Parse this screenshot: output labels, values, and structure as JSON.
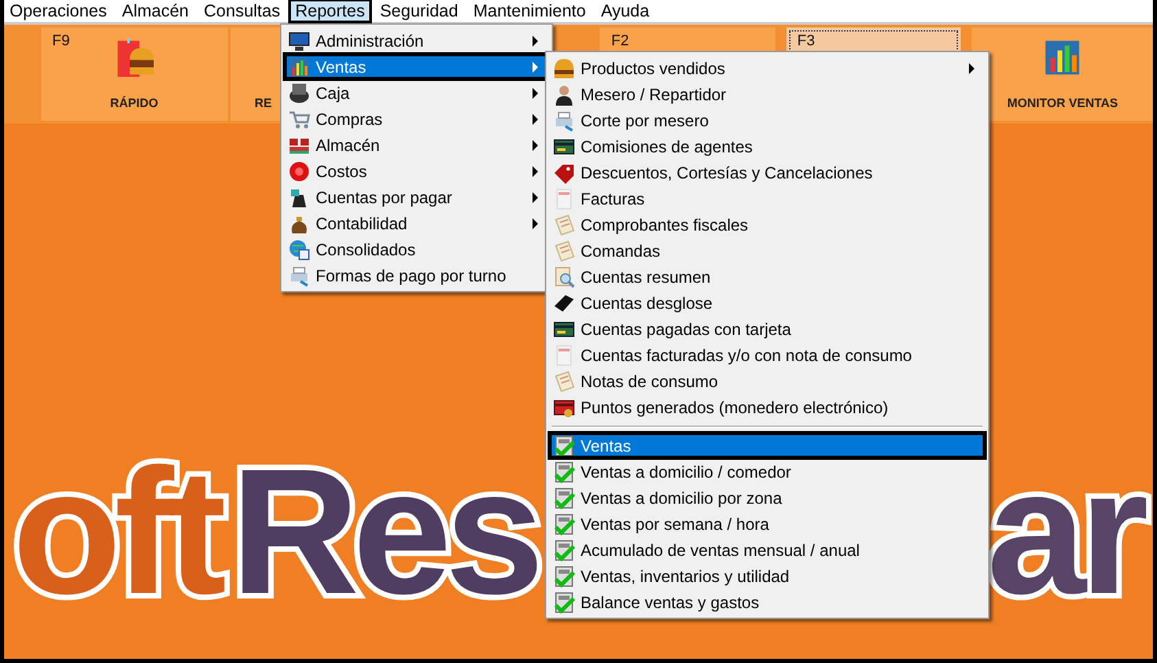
{
  "menubar": [
    {
      "label": "Operaciones",
      "selected": false
    },
    {
      "label": "Almacén",
      "selected": false
    },
    {
      "label": "Consultas",
      "selected": false
    },
    {
      "label": "Reportes",
      "selected": true
    },
    {
      "label": "Seguridad",
      "selected": false
    },
    {
      "label": "Mantenimiento",
      "selected": false
    },
    {
      "label": "Ayuda",
      "selected": false
    }
  ],
  "toolbar": [
    {
      "key": "F9",
      "label": "RÁPIDO",
      "focused": false
    },
    {
      "label": "RE",
      "focused": false
    },
    {
      "key": "F2",
      "focused": false
    },
    {
      "key": "F3",
      "focused": true
    },
    {
      "label": "MONITOR VENTAS",
      "focused": false
    }
  ],
  "logo": [
    {
      "text": "oft",
      "color": "#d9601a"
    },
    {
      "text": "Res",
      "color": "#4f3d62"
    },
    {
      "text": "ar",
      "color": "#574467"
    }
  ],
  "reportes_menu": [
    {
      "label": "Administración",
      "has_submenu": true,
      "selected": false
    },
    {
      "label": "Ventas",
      "has_submenu": true,
      "selected": true
    },
    {
      "label": "Caja",
      "has_submenu": true,
      "selected": false
    },
    {
      "label": "Compras",
      "has_submenu": true,
      "selected": false
    },
    {
      "label": "Almacén",
      "has_submenu": true,
      "selected": false
    },
    {
      "label": "Costos",
      "has_submenu": true,
      "selected": false
    },
    {
      "label": "Cuentas por pagar",
      "has_submenu": true,
      "selected": false
    },
    {
      "label": "Contabilidad",
      "has_submenu": true,
      "selected": false
    },
    {
      "label": "Consolidados",
      "has_submenu": false,
      "selected": false
    },
    {
      "label": "Formas de pago por turno",
      "has_submenu": false,
      "selected": false
    }
  ],
  "ventas_submenu": [
    [
      {
        "label": "Productos vendidos",
        "has_submenu": true,
        "selected": false
      },
      {
        "label": "Mesero / Repartidor",
        "has_submenu": false,
        "selected": false
      },
      {
        "label": "Corte por mesero",
        "has_submenu": false,
        "selected": false
      },
      {
        "label": "Comisiones de agentes",
        "has_submenu": false,
        "selected": false
      },
      {
        "label": "Descuentos, Cortesías y Cancelaciones",
        "has_submenu": false,
        "selected": false
      },
      {
        "label": "Facturas",
        "has_submenu": false,
        "selected": false
      },
      {
        "label": "Comprobantes fiscales",
        "has_submenu": false,
        "selected": false
      },
      {
        "label": "Comandas",
        "has_submenu": false,
        "selected": false
      },
      {
        "label": "Cuentas resumen",
        "has_submenu": false,
        "selected": false
      },
      {
        "label": "Cuentas desglose",
        "has_submenu": false,
        "selected": false
      },
      {
        "label": "Cuentas pagadas con tarjeta",
        "has_submenu": false,
        "selected": false
      },
      {
        "label": "Cuentas facturadas y/o con nota de consumo",
        "has_submenu": false,
        "selected": false
      },
      {
        "label": "Notas de consumo",
        "has_submenu": false,
        "selected": false
      },
      {
        "label": "Puntos generados (monedero electrónico)",
        "has_submenu": false,
        "selected": false
      }
    ],
    [
      {
        "label": "Ventas",
        "has_submenu": false,
        "selected": true
      },
      {
        "label": "Ventas a domicilio / comedor",
        "has_submenu": false,
        "selected": false
      },
      {
        "label": "Ventas a domicilio por zona",
        "has_submenu": false,
        "selected": false
      },
      {
        "label": "Ventas por semana / hora",
        "has_submenu": false,
        "selected": false
      },
      {
        "label": "Acumulado de ventas mensual / anual",
        "has_submenu": false,
        "selected": false
      },
      {
        "label": "Ventas, inventarios y utilidad",
        "has_submenu": false,
        "selected": false
      },
      {
        "label": "Balance ventas y gastos",
        "has_submenu": false,
        "selected": false
      }
    ]
  ]
}
